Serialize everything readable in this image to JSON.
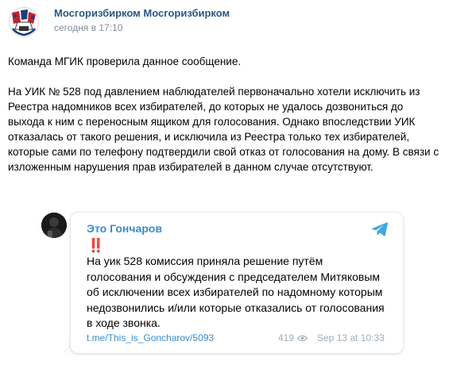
{
  "post": {
    "author": "Мосгоризбирком Мосгоризбирком",
    "time": "сегодня в 17:10",
    "paragraphs": [
      "Команда МГИК проверила данное сообщение.",
      "На УИК № 528 под давлением наблюдателей первоначально хотели исключить из Реестра надомников всех избирателей, до которых не удалось дозвониться до выхода к ним с переносным ящиком для голосования. Однако впоследствии УИК отказалась от такого решения, и исключила из Реестра только тех избирателей, которые сами по телефону подтвердили свой отказ от голосования на дому. В связи с изложенным нарушения прав избирателей в данном случае отсутствуют."
    ],
    "avatar_icon": "moscow-election-commission-logo"
  },
  "telegram": {
    "channel": "Это Гончаров",
    "exclaim": "‼️",
    "message": "На уик 528 комиссия приняла решение путём голосования и обсуждения с председателем Митяковым об исключении всех избирателей по надомному которым недозвонились и/или которые отказались от голосования в ходе звонка.",
    "link": "t.me/This_is_Goncharov/5093",
    "views": "419",
    "date": "Sep 13 at 10:33",
    "logo_icon": "telegram-plane-icon",
    "eye_icon": "eye-icon",
    "accent_color": "#3a8ccc",
    "alert_color": "#e0262a"
  },
  "colors": {
    "author_link": "#2a5885",
    "meta_gray": "#818c99",
    "telegram_gray": "#a0acb6"
  }
}
